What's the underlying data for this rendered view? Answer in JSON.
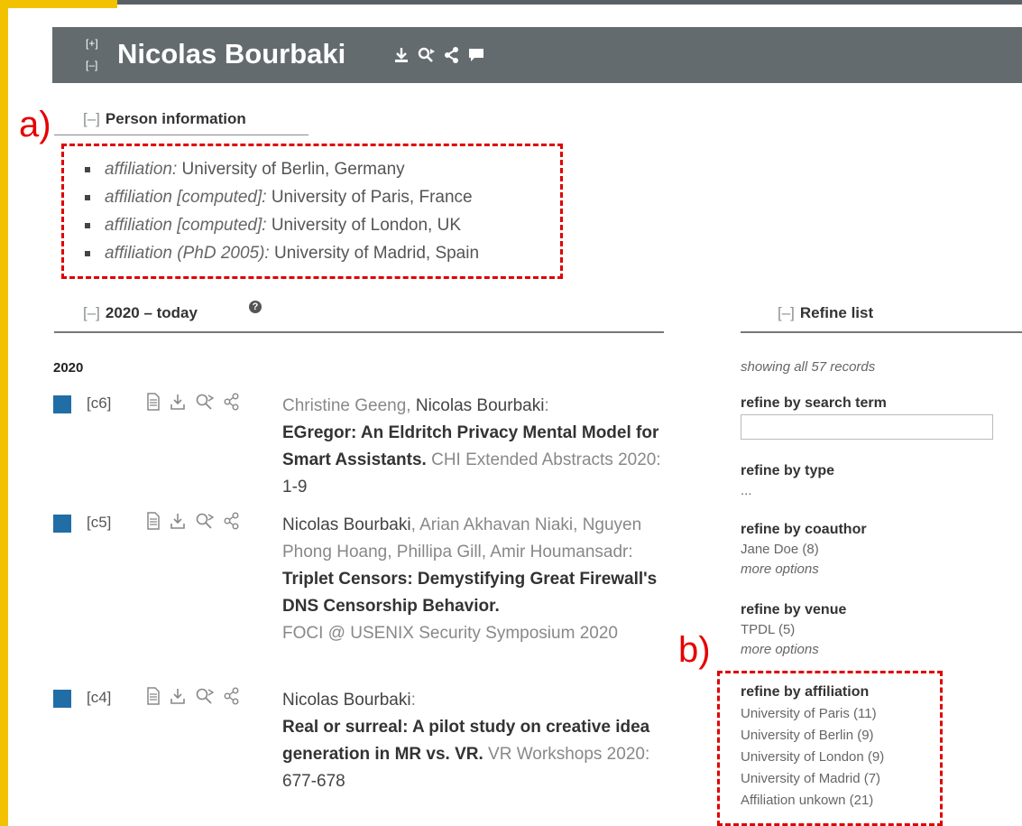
{
  "header": {
    "toggle_expand": "[+]",
    "toggle_collapse": "[–]",
    "name": "Nicolas Bourbaki"
  },
  "annotations": {
    "a": "a)",
    "b": "b)"
  },
  "person_info": {
    "toggle": "[–]",
    "heading": "Person information",
    "items": [
      {
        "label": "affiliation:",
        "value": " University of Berlin, Germany"
      },
      {
        "label": "affiliation [computed]:",
        "value": " University of Paris, France"
      },
      {
        "label": "affiliation [computed]:",
        "value": " University of London, UK"
      },
      {
        "label": "affiliation (PhD 2005):",
        "value": " University of Madrid, Spain"
      }
    ]
  },
  "publications": {
    "toggle": "[–]",
    "heading": "2020 – today",
    "help_glyph": "?",
    "year": "2020",
    "entries": [
      {
        "key": "[c6]",
        "authors": [
          {
            "name": "Christine Geeng",
            "self": false,
            "sep": ", "
          },
          {
            "name": "Nicolas Bourbaki",
            "self": true,
            "sep": ":"
          }
        ],
        "title": "EGregor: An Eldritch Privacy Mental Model for Smart Assistants.",
        "venue": "CHI Extended Abstracts 2020",
        "pages": "1-9"
      },
      {
        "key": "[c5]",
        "authors": [
          {
            "name": "Nicolas Bourbaki",
            "self": true,
            "sep": ", "
          },
          {
            "name": "Arian Akhavan Niaki",
            "self": false,
            "sep": ", "
          },
          {
            "name": "Nguyen Phong Hoang",
            "self": false,
            "sep": ", "
          },
          {
            "name": "Phillipa Gill",
            "self": false,
            "sep": ", "
          },
          {
            "name": "Amir Houmansadr",
            "self": false,
            "sep": ":"
          }
        ],
        "title": "Triplet Censors: Demystifying Great Firewall's DNS Censorship Behavior.",
        "venue": "FOCI @ USENIX Security Symposium 2020",
        "pages": ""
      },
      {
        "key": "[c4]",
        "authors": [
          {
            "name": "Nicolas Bourbaki",
            "self": true,
            "sep": ":"
          }
        ],
        "title": "Real or surreal: A pilot study on creative idea generation in MR vs. VR.",
        "venue": "VR Workshops 2020",
        "pages": "677-678"
      }
    ]
  },
  "refine": {
    "toggle": "[–]",
    "heading": "Refine list",
    "showing": "showing all 57 records",
    "search_heading": "refine by search term",
    "search_value": "",
    "type_heading": "refine by type",
    "type_value": "...",
    "coauthor_heading": "refine by coauthor",
    "coauthor_options": [
      "Jane Doe (8)"
    ],
    "coauthor_more": "more options",
    "venue_heading": "refine by venue",
    "venue_options": [
      "TPDL (5)"
    ],
    "venue_more": "more options",
    "affiliation_heading": "refine by affiliation",
    "affiliation_options": [
      "University of Paris (11)",
      "University of Berlin (9)",
      "University of London (9)",
      "University of Madrid (7)",
      "Affiliation unkown (21)"
    ]
  },
  "colors": {
    "banner": "#636b6f",
    "frame": "#f2c200",
    "annotation": "#e00000",
    "conference_marker": "#206ea5"
  }
}
